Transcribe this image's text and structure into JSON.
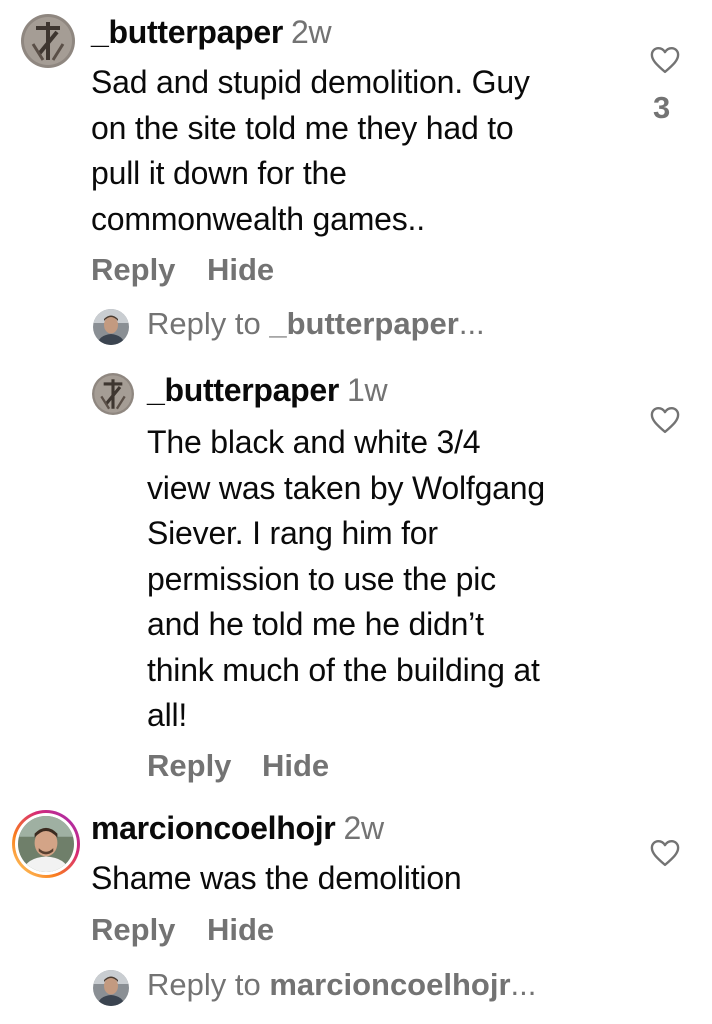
{
  "comments": [
    {
      "username": "_butterpaper",
      "time": "2w",
      "text": "Sad and stupid demolition. Guy\non the site told me they had to\npull it down for the\ncommonwealth games..",
      "reply_label": "Reply",
      "hide_label": "Hide",
      "like_count": "3"
    },
    {
      "username": "_butterpaper",
      "time": "1w",
      "text": "The black and white 3/4\nview was taken by Wolfgang\nSiever. I rang him for\npermission to use the pic\nand he told me he didn’t\nthink much of the building at\nall!",
      "reply_label": "Reply",
      "hide_label": "Hide"
    },
    {
      "username": "marcioncoelhojr",
      "time": "2w",
      "text": "Shame was the demolition",
      "reply_label": "Reply",
      "hide_label": "Hide"
    }
  ],
  "reply_prompts": [
    {
      "prefix": "Reply to ",
      "username": "_butterpaper",
      "suffix": "..."
    },
    {
      "prefix": "Reply to ",
      "username": "marcioncoelhojr",
      "suffix": "..."
    }
  ],
  "colors": {
    "secondary_text": "#737373",
    "story_ring": "#d62976"
  },
  "icons": [
    "heart-icon",
    "avatar"
  ]
}
